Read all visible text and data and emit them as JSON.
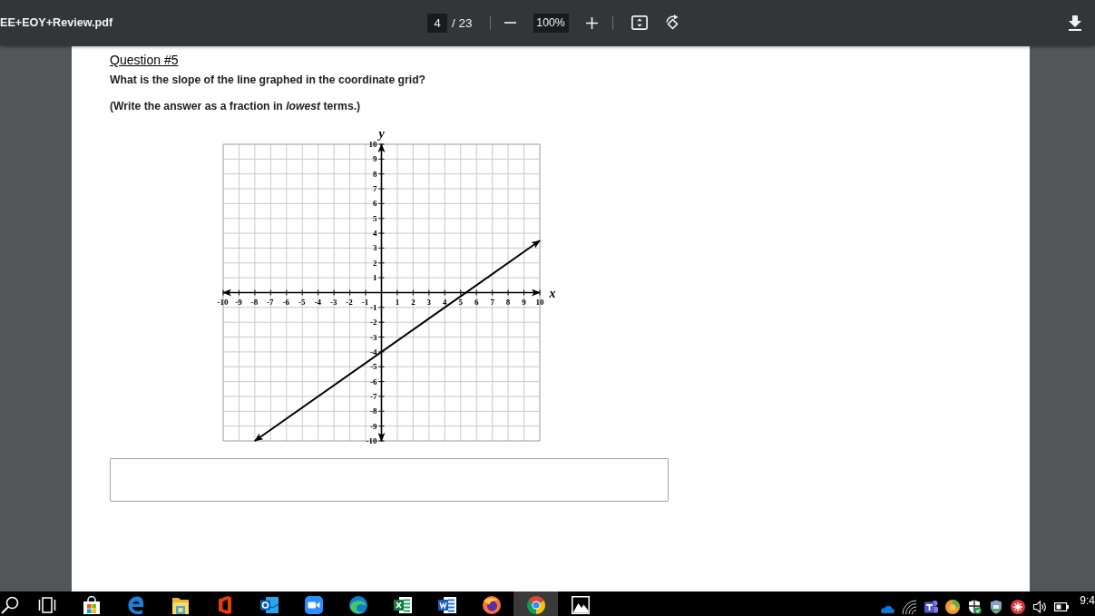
{
  "toolbar": {
    "title": "EE+EOY+Review.pdf",
    "page_number": "4",
    "page_count": "/ 23",
    "zoom": "100%"
  },
  "document": {
    "heading": "Question #5",
    "question": "What is the slope of the line graphed in the coordinate grid?",
    "instruction": "(Write the answer as a fraction in *lowest* terms.)",
    "graph": {
      "chart_data": {
        "type": "line",
        "xlabel": "x",
        "ylabel": "y",
        "x": [
          -8,
          10
        ],
        "series": [
          {
            "values": [
              -10,
              3.5
            ]
          }
        ],
        "xlim": [
          -10,
          10
        ],
        "ylim": [
          -10,
          10
        ],
        "xticks": [
          -10,
          -9,
          -8,
          -7,
          -6,
          -5,
          -4,
          -3,
          -2,
          -1,
          1,
          2,
          3,
          4,
          5,
          6,
          7,
          8,
          9,
          10
        ],
        "yticks": [
          -10,
          -9,
          -8,
          -7,
          -6,
          -5,
          -4,
          -3,
          -2,
          -1,
          1,
          2,
          3,
          4,
          5,
          6,
          7,
          8,
          9,
          10
        ],
        "grid": true
      }
    }
  },
  "taskbar": {
    "apps": [
      {
        "kind": "search",
        "selected": false
      },
      {
        "kind": "taskview",
        "selected": false
      },
      {
        "kind": "store",
        "selected": false
      },
      {
        "kind": "legacyedge",
        "selected": false
      },
      {
        "kind": "explorer",
        "selected": false
      },
      {
        "kind": "office",
        "selected": false
      },
      {
        "kind": "outlook",
        "selected": false
      },
      {
        "kind": "zoom",
        "selected": false
      },
      {
        "kind": "edge",
        "selected": false
      },
      {
        "kind": "excel",
        "selected": false
      },
      {
        "kind": "word",
        "selected": false
      },
      {
        "kind": "firefox",
        "selected": false
      },
      {
        "kind": "chrome",
        "selected": true
      },
      {
        "kind": "photos",
        "selected": false
      }
    ],
    "tray": [
      {
        "kind": "cloud"
      },
      {
        "kind": "wifi"
      },
      {
        "kind": "teams"
      },
      {
        "kind": "disc"
      },
      {
        "kind": "shieldcheck"
      },
      {
        "kind": "shield"
      },
      {
        "kind": "starburst"
      },
      {
        "kind": "volume"
      },
      {
        "kind": "battery"
      }
    ],
    "clock": "9:4"
  }
}
